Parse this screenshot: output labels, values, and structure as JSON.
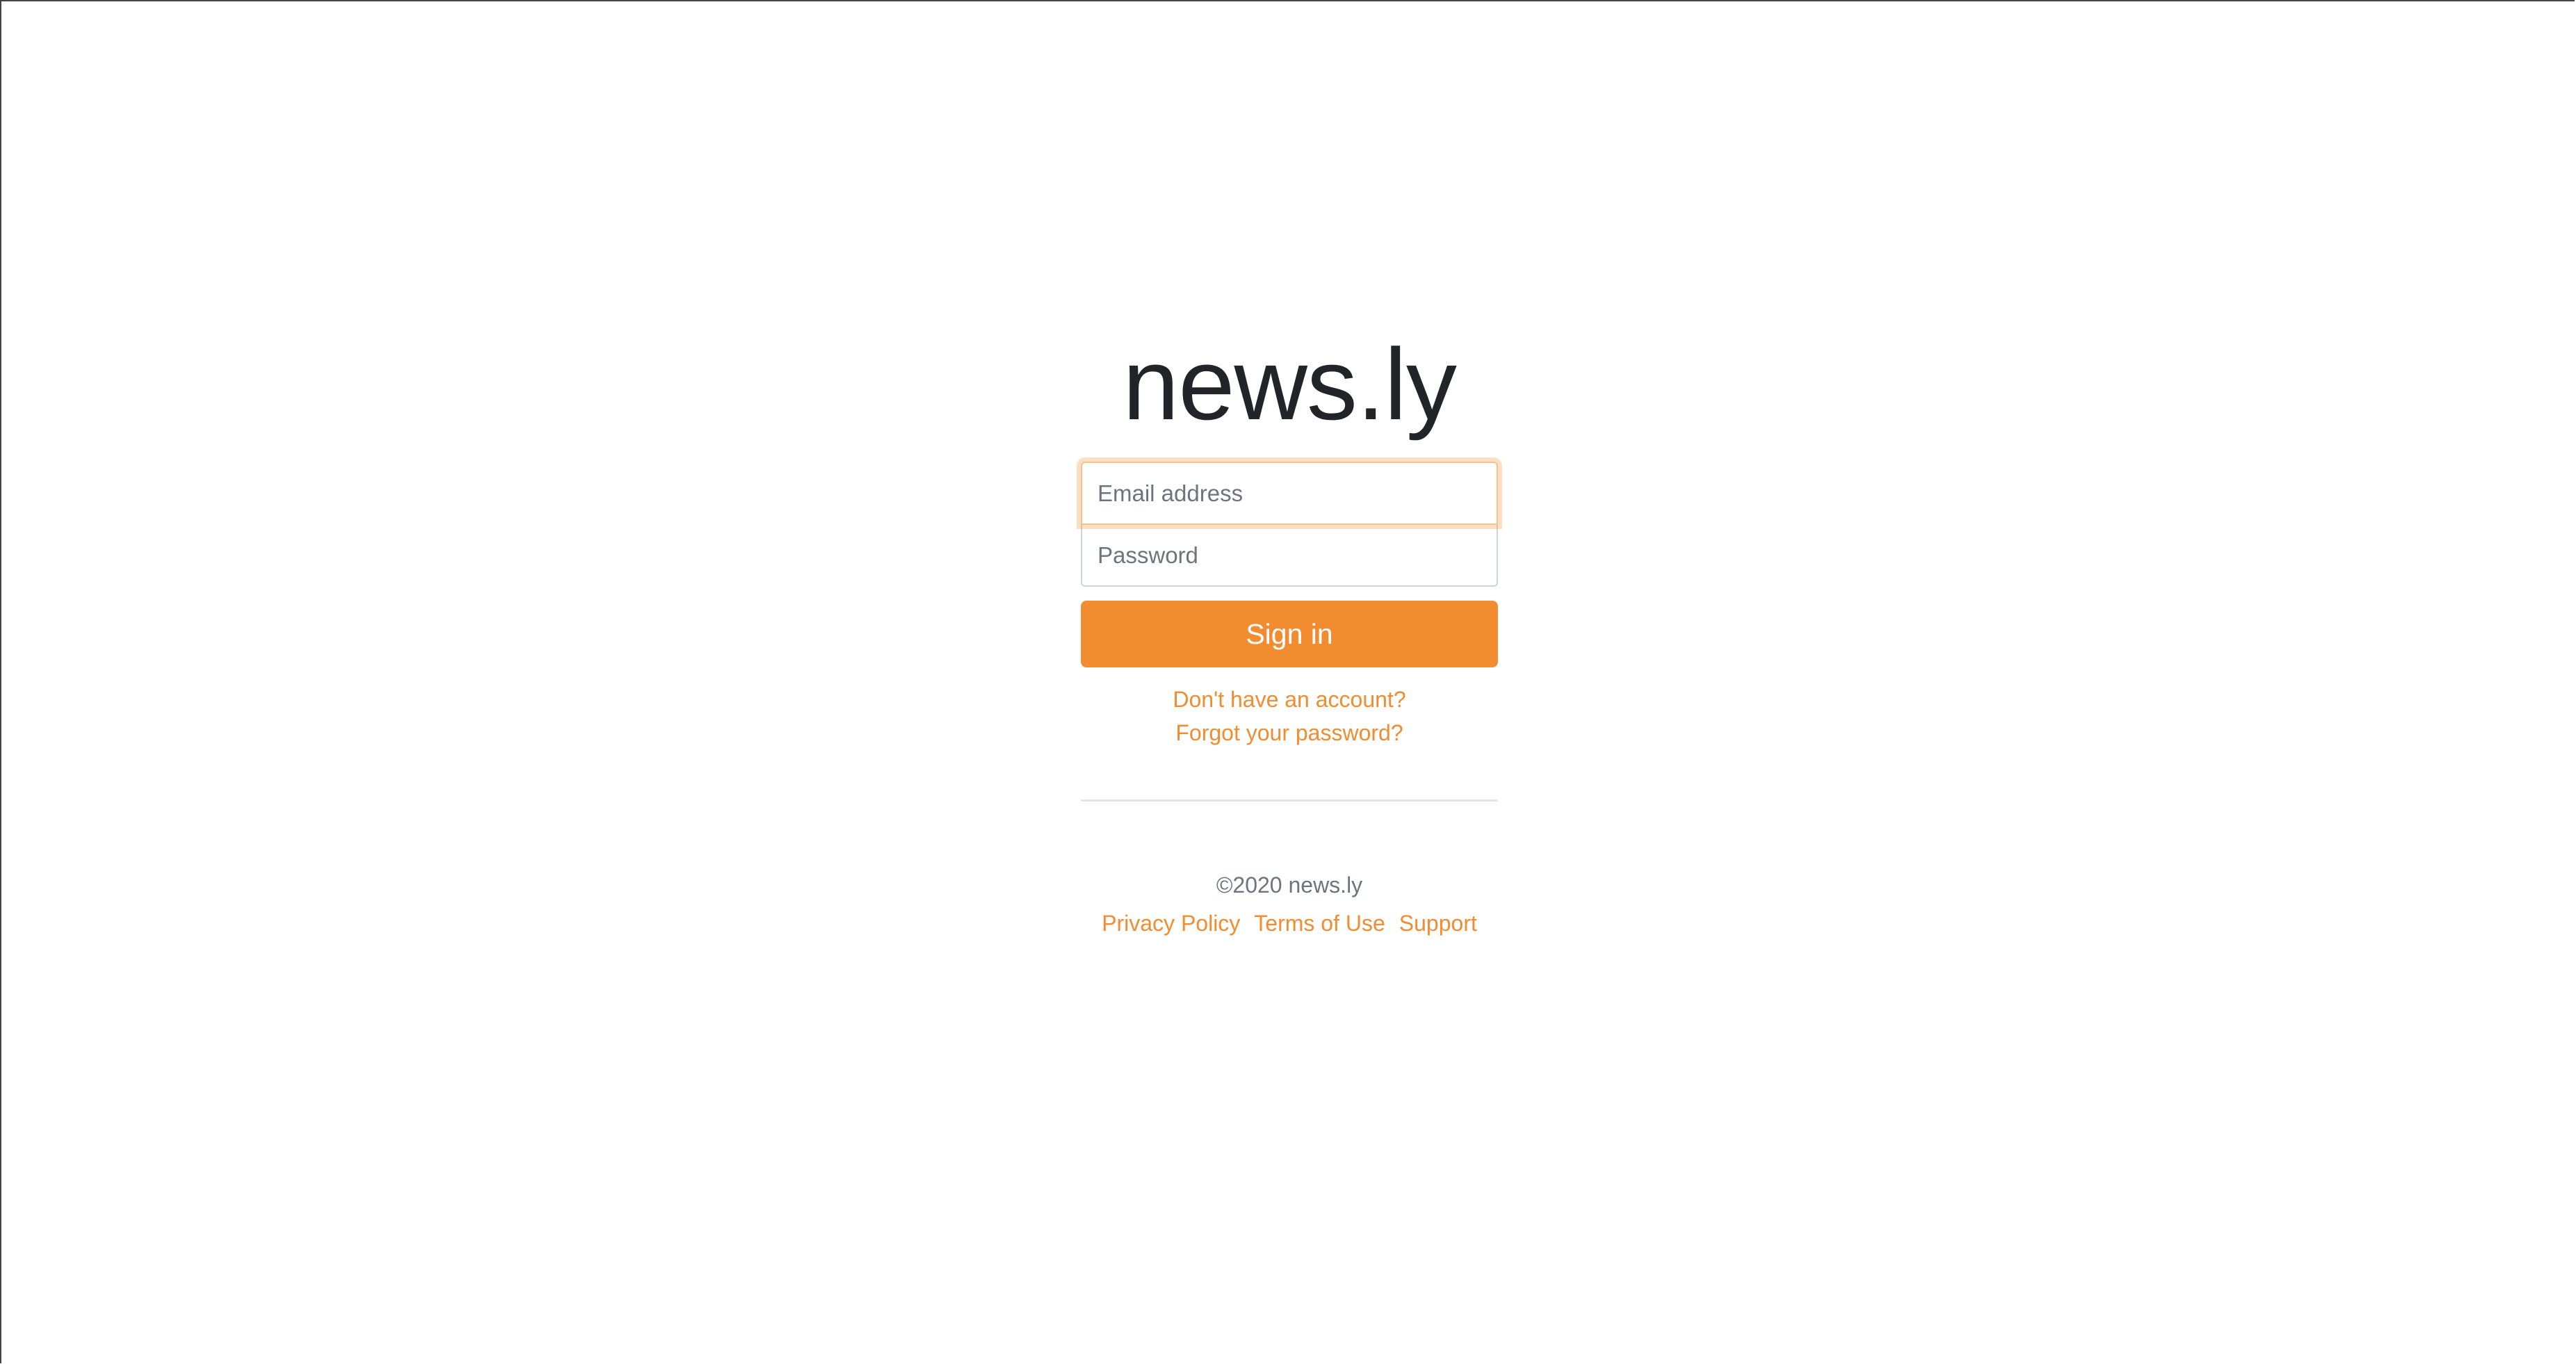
{
  "brand": {
    "title": "news.ly",
    "accent_color": "#f28c30"
  },
  "login_form": {
    "email_placeholder": "Email address",
    "email_value": "",
    "password_placeholder": "Password",
    "password_value": "",
    "submit_label": "Sign in"
  },
  "help_links": {
    "signup": "Don't have an account?",
    "forgot_password": "Forgot your password?"
  },
  "footer": {
    "copyright": "©2020 news.ly",
    "links": [
      {
        "label": "Privacy Policy"
      },
      {
        "label": "Terms of Use"
      },
      {
        "label": "Support"
      }
    ]
  }
}
